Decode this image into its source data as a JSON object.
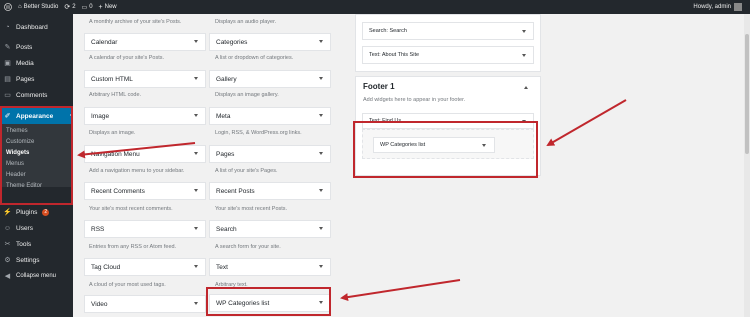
{
  "adminbar": {
    "site_name": "Better Studio",
    "updates_count": "2",
    "comments_count": "0",
    "new_label": "New",
    "howdy": "Howdy, admin"
  },
  "sidebar": {
    "items": [
      {
        "label": "Dashboard",
        "icon": "dashboard-icon"
      },
      {
        "label": "Posts",
        "icon": "pin-icon"
      },
      {
        "label": "Media",
        "icon": "media-icon"
      },
      {
        "label": "Pages",
        "icon": "page-icon"
      },
      {
        "label": "Comments",
        "icon": "comment-icon"
      },
      {
        "label": "Appearance",
        "icon": "brush-icon"
      },
      {
        "label": "Plugins",
        "icon": "plug-icon",
        "badge": "2"
      },
      {
        "label": "Users",
        "icon": "user-icon"
      },
      {
        "label": "Tools",
        "icon": "wrench-icon"
      },
      {
        "label": "Settings",
        "icon": "settings-icon"
      },
      {
        "label": "Collapse menu",
        "icon": "collapse-icon"
      }
    ],
    "submenu": [
      "Themes",
      "Customize",
      "Widgets",
      "Menus",
      "Header",
      "Theme Editor"
    ]
  },
  "widgets_left": {
    "top_desc": "A monthly archive of your site's Posts.",
    "items": [
      {
        "name": "Calendar",
        "desc": "A calendar of your site's Posts."
      },
      {
        "name": "Custom HTML",
        "desc": "Arbitrary HTML code."
      },
      {
        "name": "Image",
        "desc": "Displays an image."
      },
      {
        "name": "Navigation Menu",
        "desc": "Add a navigation menu to your sidebar."
      },
      {
        "name": "Recent Comments",
        "desc": "Your site's most recent comments."
      },
      {
        "name": "RSS",
        "desc": "Entries from any RSS or Atom feed."
      },
      {
        "name": "Tag Cloud",
        "desc": "A cloud of your most used tags."
      },
      {
        "name": "Video",
        "desc": ""
      }
    ]
  },
  "widgets_right": {
    "top_desc": "Displays an audio player.",
    "items": [
      {
        "name": "Categories",
        "desc": "A list or dropdown of categories."
      },
      {
        "name": "Gallery",
        "desc": "Displays an image gallery."
      },
      {
        "name": "Meta",
        "desc": "Login, RSS, & WordPress.org links."
      },
      {
        "name": "Pages",
        "desc": "A list of your site's Pages."
      },
      {
        "name": "Recent Posts",
        "desc": "Your site's most recent Posts."
      },
      {
        "name": "Search",
        "desc": "A search form for your site."
      },
      {
        "name": "Text",
        "desc": "Arbitrary text."
      },
      {
        "name": "WP Categories list",
        "desc": ""
      }
    ]
  },
  "areas": {
    "sidebar_widgets": [
      "Search: Search",
      "Text: About This Site"
    ],
    "footer_title": "Footer 1",
    "footer_desc": "Add widgets here to appear in your footer.",
    "footer_widget": "Text: Find Us",
    "dragging_widget": "WP Categories list"
  },
  "colors": {
    "admin_bar": "#23282d",
    "active_menu": "#0073aa",
    "highlight": "#c0272d"
  }
}
